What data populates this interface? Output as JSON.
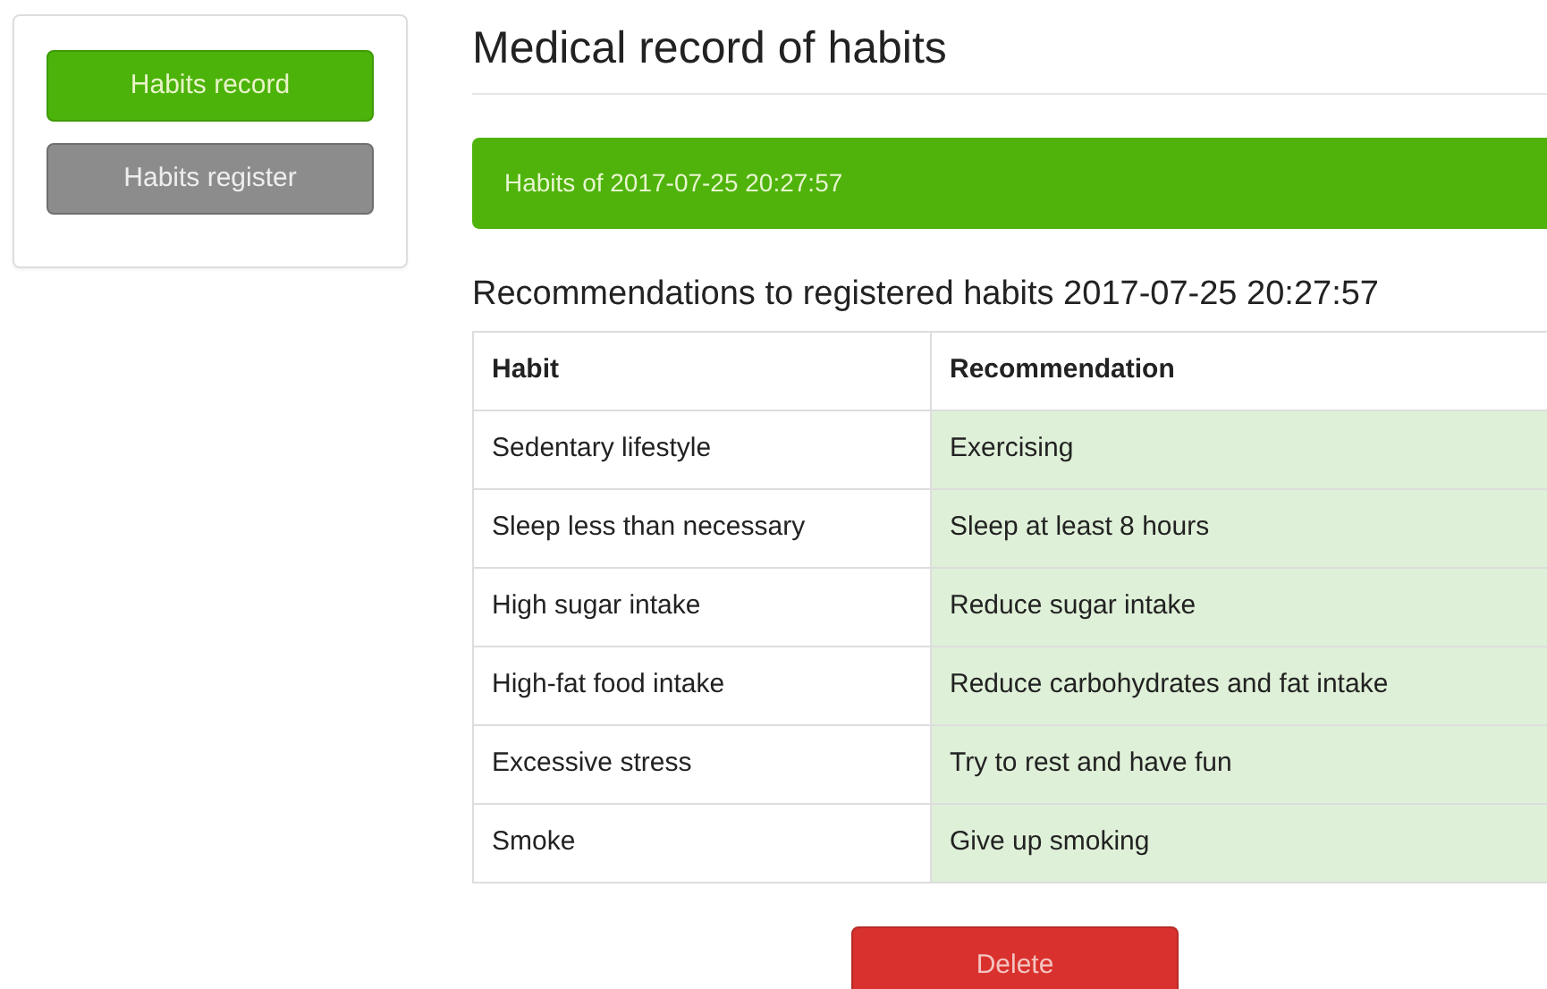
{
  "sidebar": {
    "items": [
      {
        "label": "Habits record",
        "selected": true
      },
      {
        "label": "Habits register",
        "selected": false
      }
    ]
  },
  "title": "Medical record of habits",
  "panel": {
    "heading": "Habits of 2017-07-25 20:27:57"
  },
  "subtitle": "Recommendations to registered habits 2017-07-25 20:27:57",
  "table": {
    "columns": [
      "Habit",
      "Recommendation"
    ],
    "rows": [
      [
        "Sedentary lifestyle",
        "Exercising"
      ],
      [
        "Sleep less than necessary",
        "Sleep at least 8 hours"
      ],
      [
        "High sugar intake",
        "Reduce sugar intake"
      ],
      [
        "High-fat food intake",
        "Reduce carbohydrates and fat intake"
      ],
      [
        "Excessive stress",
        "Try to rest and have fun"
      ],
      [
        "Smoke",
        "Give up smoking"
      ]
    ]
  },
  "delete_button": "Delete"
}
